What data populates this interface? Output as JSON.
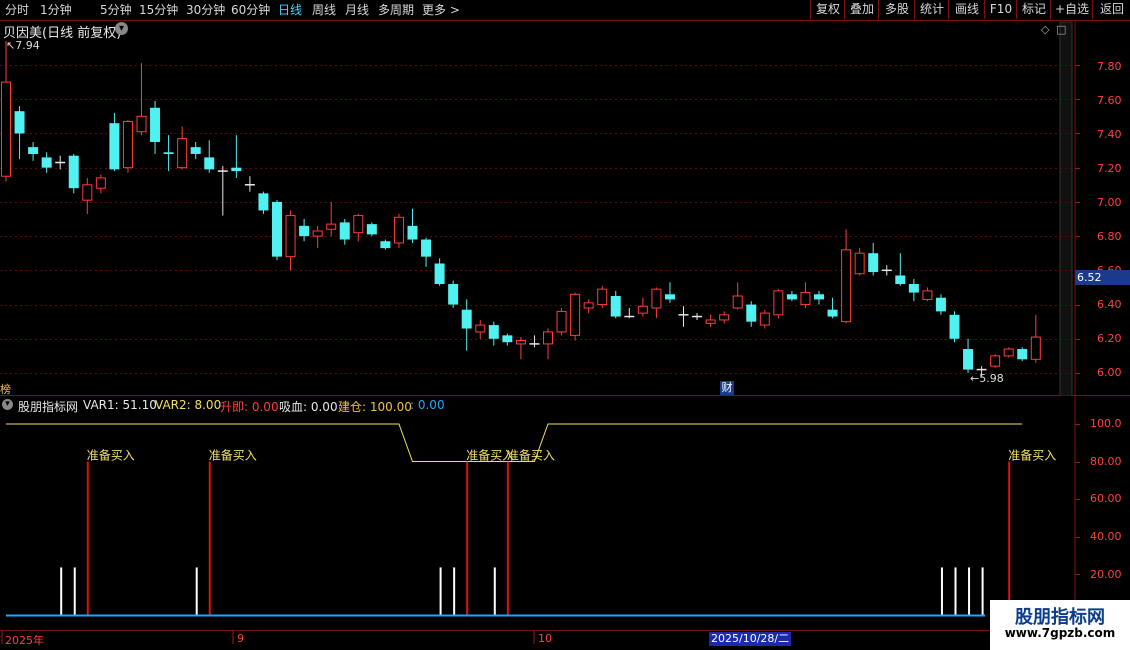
{
  "toolbar": {
    "periods": [
      "分时",
      "1分钟",
      "5分钟",
      "15分钟",
      "30分钟",
      "60分钟",
      "日线",
      "周线",
      "月线",
      "多周期",
      "更多 >"
    ],
    "active_period": "日线",
    "buttons": [
      "复权",
      "叠加",
      "多股",
      "统计",
      "画线",
      "F10",
      "标记",
      "+自选",
      "返回"
    ]
  },
  "main_chart": {
    "title": "贝因美(日线 前复权)",
    "high_label": "7.94",
    "low_label": "5.98",
    "current_price": "6.52",
    "y_ticks": [
      "7.80",
      "7.60",
      "7.40",
      "7.20",
      "7.00",
      "6.80",
      "6.60",
      "6.40",
      "6.20",
      "6.00"
    ],
    "left_flag": "榜",
    "event_flag": "财"
  },
  "indicator": {
    "name": "股朋指标网",
    "var1": "VAR1: 51.10",
    "var2": "VAR2: 8.00",
    "rise": "升即: 0.00",
    "absorb": "吸血: 0.00",
    "build": "建仓: 100.00",
    "extra": ": 0.00",
    "y_ticks": [
      "100.0",
      "80.00",
      "60.00",
      "40.00",
      "20.00"
    ],
    "signal_text": "准备买入"
  },
  "time_axis": {
    "year": "2025年",
    "month_9": "9",
    "month_10": "10",
    "cursor_date": "2025/10/28/二"
  },
  "watermark": {
    "title": "股朋指标网",
    "url": "www.7gpzb.com"
  },
  "colors": {
    "up": "#ff3b3b",
    "down": "#52f1f1",
    "grid": "#5a0c0c",
    "yellow": "#f0e060",
    "blue": "#1ea7ff"
  },
  "chart_data": {
    "type": "candlestick",
    "ylim": [
      5.9,
      8.0
    ],
    "candles": [
      {
        "o": 7.15,
        "c": 7.7,
        "h": 7.94,
        "l": 7.12
      },
      {
        "o": 7.53,
        "c": 7.4,
        "h": 7.56,
        "l": 7.25
      },
      {
        "o": 7.32,
        "c": 7.28,
        "h": 7.35,
        "l": 7.24
      },
      {
        "o": 7.26,
        "c": 7.2,
        "h": 7.29,
        "l": 7.17
      },
      {
        "o": 7.23,
        "c": 7.23,
        "h": 7.27,
        "l": 7.19
      },
      {
        "o": 7.27,
        "c": 7.08,
        "h": 7.28,
        "l": 7.05
      },
      {
        "o": 7.01,
        "c": 7.1,
        "h": 7.14,
        "l": 6.93
      },
      {
        "o": 7.08,
        "c": 7.14,
        "h": 7.16,
        "l": 7.05
      },
      {
        "o": 7.46,
        "c": 7.19,
        "h": 7.52,
        "l": 7.18
      },
      {
        "o": 7.2,
        "c": 7.47,
        "h": 7.48,
        "l": 7.17
      },
      {
        "o": 7.41,
        "c": 7.5,
        "h": 7.81,
        "l": 7.39
      },
      {
        "o": 7.55,
        "c": 7.35,
        "h": 7.59,
        "l": 7.28
      },
      {
        "o": 7.29,
        "c": 7.28,
        "h": 7.39,
        "l": 7.18
      },
      {
        "o": 7.2,
        "c": 7.37,
        "h": 7.44,
        "l": 7.19
      },
      {
        "o": 7.32,
        "c": 7.28,
        "h": 7.35,
        "l": 7.25
      },
      {
        "o": 7.26,
        "c": 7.19,
        "h": 7.36,
        "l": 7.17
      },
      {
        "o": 7.18,
        "c": 7.18,
        "h": 7.21,
        "l": 6.92
      },
      {
        "o": 7.2,
        "c": 7.18,
        "h": 7.39,
        "l": 7.14
      },
      {
        "o": 7.1,
        "c": 7.1,
        "h": 7.15,
        "l": 7.06
      },
      {
        "o": 7.05,
        "c": 6.95,
        "h": 7.06,
        "l": 6.93
      },
      {
        "o": 7.0,
        "c": 6.68,
        "h": 7.01,
        "l": 6.66
      },
      {
        "o": 6.68,
        "c": 6.92,
        "h": 6.95,
        "l": 6.6
      },
      {
        "o": 6.86,
        "c": 6.8,
        "h": 6.9,
        "l": 6.77
      },
      {
        "o": 6.8,
        "c": 6.83,
        "h": 6.86,
        "l": 6.73
      },
      {
        "o": 6.84,
        "c": 6.87,
        "h": 7.0,
        "l": 6.8
      },
      {
        "o": 6.88,
        "c": 6.78,
        "h": 6.9,
        "l": 6.75
      },
      {
        "o": 6.82,
        "c": 6.92,
        "h": 6.93,
        "l": 6.77
      },
      {
        "o": 6.87,
        "c": 6.81,
        "h": 6.88,
        "l": 6.8
      },
      {
        "o": 6.77,
        "c": 6.73,
        "h": 6.78,
        "l": 6.72
      },
      {
        "o": 6.76,
        "c": 6.91,
        "h": 6.93,
        "l": 6.73
      },
      {
        "o": 6.86,
        "c": 6.78,
        "h": 6.96,
        "l": 6.76
      },
      {
        "o": 6.78,
        "c": 6.68,
        "h": 6.79,
        "l": 6.62
      },
      {
        "o": 6.64,
        "c": 6.52,
        "h": 6.67,
        "l": 6.51
      },
      {
        "o": 6.52,
        "c": 6.4,
        "h": 6.54,
        "l": 6.38
      },
      {
        "o": 6.37,
        "c": 6.26,
        "h": 6.43,
        "l": 6.13
      },
      {
        "o": 6.24,
        "c": 6.28,
        "h": 6.31,
        "l": 6.2
      },
      {
        "o": 6.28,
        "c": 6.2,
        "h": 6.3,
        "l": 6.16
      },
      {
        "o": 6.22,
        "c": 6.18,
        "h": 6.23,
        "l": 6.16
      },
      {
        "o": 6.17,
        "c": 6.19,
        "h": 6.21,
        "l": 6.08
      },
      {
        "o": 6.17,
        "c": 6.17,
        "h": 6.22,
        "l": 6.15
      },
      {
        "o": 6.17,
        "c": 6.24,
        "h": 6.26,
        "l": 6.08
      },
      {
        "o": 6.24,
        "c": 6.36,
        "h": 6.38,
        "l": 6.22
      },
      {
        "o": 6.22,
        "c": 6.46,
        "h": 6.47,
        "l": 6.19
      },
      {
        "o": 6.38,
        "c": 6.41,
        "h": 6.43,
        "l": 6.35
      },
      {
        "o": 6.4,
        "c": 6.49,
        "h": 6.51,
        "l": 6.38
      },
      {
        "o": 6.45,
        "c": 6.33,
        "h": 6.48,
        "l": 6.32
      },
      {
        "o": 6.33,
        "c": 6.33,
        "h": 6.38,
        "l": 6.32
      },
      {
        "o": 6.35,
        "c": 6.39,
        "h": 6.44,
        "l": 6.33
      },
      {
        "o": 6.38,
        "c": 6.49,
        "h": 6.5,
        "l": 6.32
      },
      {
        "o": 6.46,
        "c": 6.43,
        "h": 6.53,
        "l": 6.41
      },
      {
        "o": 6.34,
        "c": 6.34,
        "h": 6.39,
        "l": 6.27
      },
      {
        "o": 6.33,
        "c": 6.33,
        "h": 6.35,
        "l": 6.31
      },
      {
        "o": 6.29,
        "c": 6.31,
        "h": 6.34,
        "l": 6.27
      },
      {
        "o": 6.31,
        "c": 6.34,
        "h": 6.36,
        "l": 6.29
      },
      {
        "o": 6.38,
        "c": 6.45,
        "h": 6.53,
        "l": 6.37
      },
      {
        "o": 6.4,
        "c": 6.3,
        "h": 6.42,
        "l": 6.27
      },
      {
        "o": 6.28,
        "c": 6.35,
        "h": 6.37,
        "l": 6.26
      },
      {
        "o": 6.34,
        "c": 6.48,
        "h": 6.49,
        "l": 6.32
      },
      {
        "o": 6.46,
        "c": 6.43,
        "h": 6.48,
        "l": 6.42
      },
      {
        "o": 6.4,
        "c": 6.47,
        "h": 6.53,
        "l": 6.38
      },
      {
        "o": 6.46,
        "c": 6.43,
        "h": 6.48,
        "l": 6.4
      },
      {
        "o": 6.37,
        "c": 6.33,
        "h": 6.44,
        "l": 6.32
      },
      {
        "o": 6.3,
        "c": 6.72,
        "h": 6.84,
        "l": 6.29
      },
      {
        "o": 6.58,
        "c": 6.7,
        "h": 6.73,
        "l": 6.57
      },
      {
        "o": 6.7,
        "c": 6.59,
        "h": 6.76,
        "l": 6.57
      },
      {
        "o": 6.6,
        "c": 6.6,
        "h": 6.63,
        "l": 6.57
      },
      {
        "o": 6.57,
        "c": 6.52,
        "h": 6.7,
        "l": 6.51
      },
      {
        "o": 6.52,
        "c": 6.47,
        "h": 6.55,
        "l": 6.42
      },
      {
        "o": 6.43,
        "c": 6.48,
        "h": 6.5,
        "l": 6.42
      },
      {
        "o": 6.44,
        "c": 6.36,
        "h": 6.46,
        "l": 6.34
      },
      {
        "o": 6.34,
        "c": 6.2,
        "h": 6.36,
        "l": 6.18
      },
      {
        "o": 6.14,
        "c": 6.02,
        "h": 6.2,
        "l": 6.0
      },
      {
        "o": 6.02,
        "c": 6.02,
        "h": 6.04,
        "l": 5.98
      },
      {
        "o": 6.04,
        "c": 6.1,
        "h": 6.11,
        "l": 6.03
      },
      {
        "o": 6.1,
        "c": 6.14,
        "h": 6.15,
        "l": 6.09
      },
      {
        "o": 6.14,
        "c": 6.08,
        "h": 6.15,
        "l": 6.07
      },
      {
        "o": 6.08,
        "c": 6.21,
        "h": 6.34,
        "l": 6.06
      }
    ],
    "indicator": {
      "build_line_breakpoints": [
        [
          0,
          100
        ],
        [
          29,
          100
        ],
        [
          30,
          80
        ],
        [
          39,
          80
        ],
        [
          40,
          100
        ],
        [
          75,
          100
        ]
      ],
      "buy_signal_indices": [
        6,
        15,
        34,
        37,
        74
      ],
      "white_bar_indices": [
        4,
        5,
        14,
        32,
        33,
        36,
        69,
        70,
        71,
        72
      ]
    }
  }
}
